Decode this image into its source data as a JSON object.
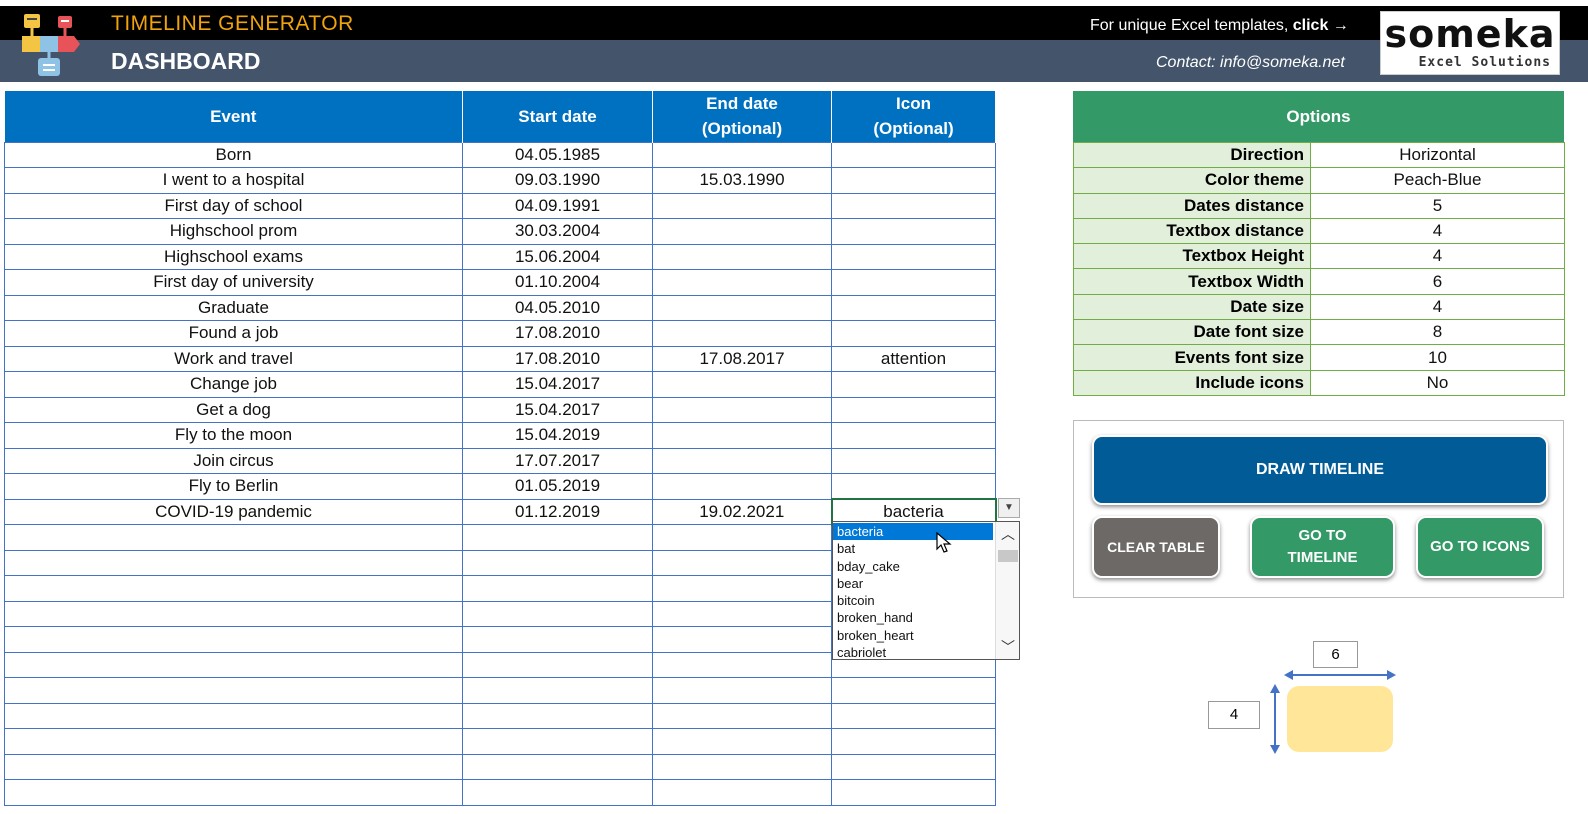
{
  "header": {
    "app_title": "TIMELINE GENERATOR",
    "page_title": "DASHBOARD",
    "promo_text": "For unique Excel templates, ",
    "promo_link": "click →",
    "contact": "Contact: info@someka.net",
    "logo_main": "someka",
    "logo_sub": "Excel Solutions"
  },
  "table": {
    "headers": [
      "Event",
      "Start date",
      "End date\n(Optional)",
      "Icon\n(Optional)"
    ],
    "rows": [
      [
        "Born",
        "04.05.1985",
        "",
        ""
      ],
      [
        "I went to a hospital",
        "09.03.1990",
        "15.03.1990",
        ""
      ],
      [
        "First day of school",
        "04.09.1991",
        "",
        ""
      ],
      [
        "Highschool prom",
        "30.03.2004",
        "",
        ""
      ],
      [
        "Highschool exams",
        "15.06.2004",
        "",
        ""
      ],
      [
        "First day of university",
        "01.10.2004",
        "",
        ""
      ],
      [
        "Graduate",
        "04.05.2010",
        "",
        ""
      ],
      [
        "Found a job",
        "17.08.2010",
        "",
        ""
      ],
      [
        "Work and travel",
        "17.08.2010",
        "17.08.2017",
        "attention"
      ],
      [
        "Change job",
        "15.04.2017",
        "",
        ""
      ],
      [
        "Get a dog",
        "15.04.2017",
        "",
        ""
      ],
      [
        "Fly to the moon",
        "15.04.2019",
        "",
        ""
      ],
      [
        "Join circus",
        "17.07.2017",
        "",
        ""
      ],
      [
        "Fly to Berlin",
        "01.05.2019",
        "",
        ""
      ],
      [
        "COVID-19 pandemic",
        "01.12.2019",
        "19.02.2021",
        "bacteria"
      ],
      [
        "",
        "",
        "",
        ""
      ],
      [
        "",
        "",
        "",
        ""
      ],
      [
        "",
        "",
        "",
        ""
      ],
      [
        "",
        "",
        "",
        ""
      ],
      [
        "",
        "",
        "",
        ""
      ],
      [
        "",
        "",
        "",
        ""
      ],
      [
        "",
        "",
        "",
        ""
      ],
      [
        "",
        "",
        "",
        ""
      ],
      [
        "",
        "",
        "",
        ""
      ],
      [
        "",
        "",
        "",
        ""
      ],
      [
        "",
        "",
        "",
        ""
      ]
    ]
  },
  "dropdown": {
    "options": [
      "bacteria",
      "bat",
      "bday_cake",
      "bear",
      "bitcoin",
      "broken_hand",
      "broken_heart",
      "cabriolet"
    ],
    "highlighted": "bacteria"
  },
  "options": {
    "title": "Options",
    "items": [
      {
        "label": "Direction",
        "value": "Horizontal"
      },
      {
        "label": "Color theme",
        "value": "Peach-Blue"
      },
      {
        "label": "Dates distance",
        "value": "5"
      },
      {
        "label": "Textbox distance",
        "value": "4"
      },
      {
        "label": "Textbox Height",
        "value": "4"
      },
      {
        "label": "Textbox Width",
        "value": "6"
      },
      {
        "label": "Date size",
        "value": "4"
      },
      {
        "label": "Date font size",
        "value": "8"
      },
      {
        "label": "Events font size",
        "value": "10"
      },
      {
        "label": "Include  icons",
        "value": "No"
      }
    ]
  },
  "buttons": {
    "draw": "DRAW TIMELINE",
    "clear": "CLEAR TABLE",
    "timeline": "GO TO\nTIMELINE",
    "icons": "GO TO ICONS"
  },
  "preview": {
    "width": "6",
    "height": "4"
  },
  "colors": {
    "header_black": "#000000",
    "header_slate": "#44546a",
    "title_orange": "#f0a30a",
    "table_blue": "#0070c0",
    "options_green": "#339966",
    "draw_blue": "#005b96",
    "preview_fill": "#ffe699"
  }
}
